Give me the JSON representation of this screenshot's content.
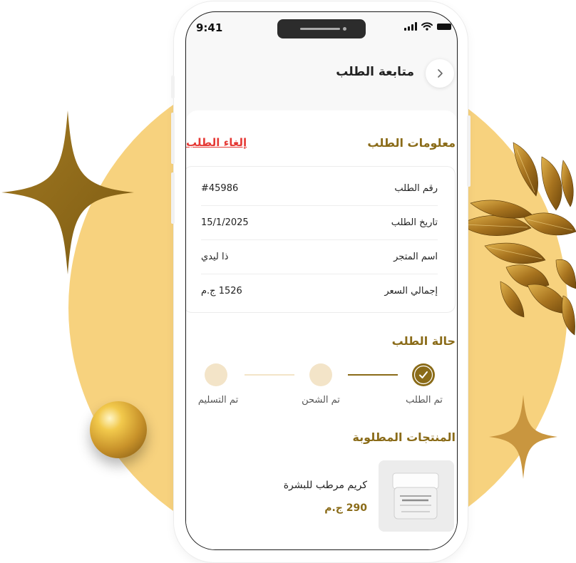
{
  "colors": {
    "accent_gold": "#8a6b18",
    "background_circle": "#f7d27e",
    "cancel_red": "#e53935",
    "step_inactive": "#f3e4c8"
  },
  "status_bar": {
    "time": "9:41",
    "icons": [
      "signal-icon",
      "wifi-icon",
      "battery-icon"
    ]
  },
  "header": {
    "title": "متابعة الطلب",
    "back_icon": "chevron-right-icon"
  },
  "order_info": {
    "section_title": "معلومات الطلب",
    "cancel_label": "إلغاء الطلب",
    "rows": [
      {
        "label": "رقم الطلب",
        "value": "#45986"
      },
      {
        "label": "تاريخ الطلب",
        "value": "15/1/2025"
      },
      {
        "label": "اسم المتجر",
        "value": "ذا ليدي"
      },
      {
        "label": "إجمالي السعر",
        "value": "1526 ج.م"
      }
    ]
  },
  "order_status": {
    "section_title": "حالة الطلب",
    "steps": [
      {
        "label": "تم الطلب",
        "completed": true
      },
      {
        "label": "تم الشحن",
        "completed": false
      },
      {
        "label": "تم التسليم",
        "completed": false
      }
    ],
    "check_icon": "check-icon"
  },
  "products": {
    "section_title": "المنتجات المطلوبة",
    "items": [
      {
        "name": "كريم مرطب للبشرة",
        "price": "290 ج.م",
        "image_icon": "cream-jar-icon"
      }
    ]
  }
}
